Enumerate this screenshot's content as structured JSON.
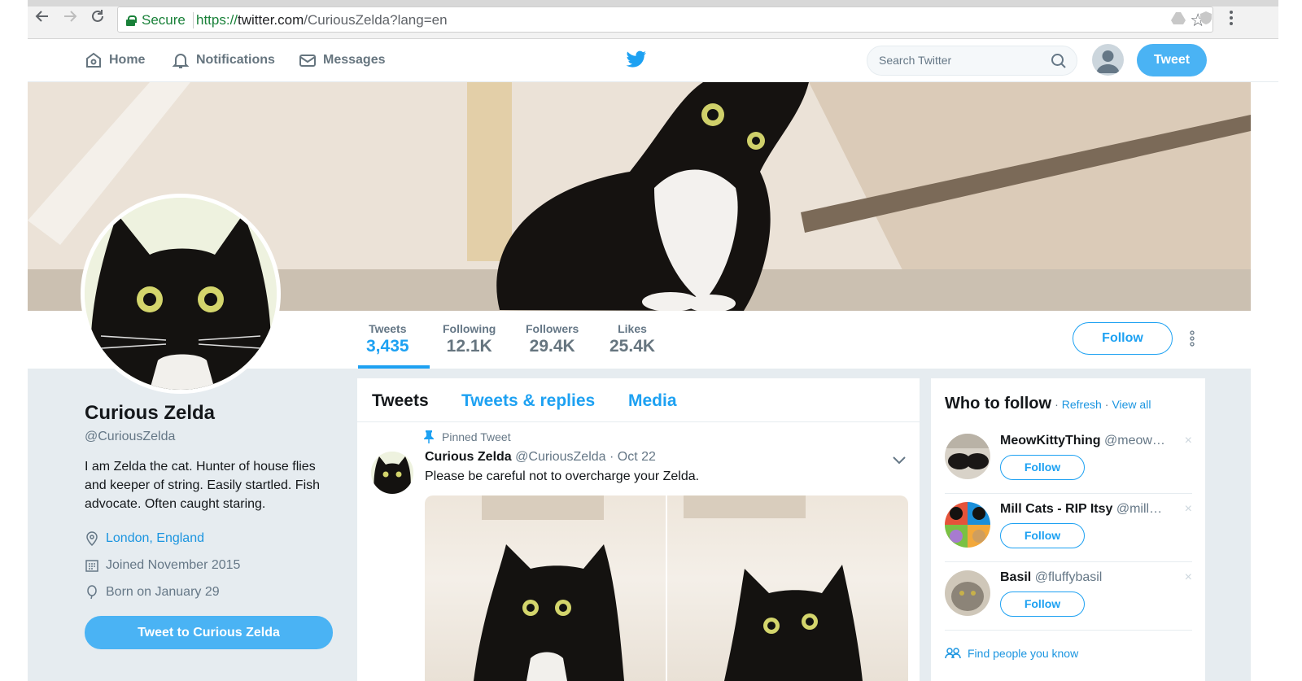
{
  "browser": {
    "secure_label": "Secure",
    "url_scheme": "https://",
    "url_host": "twitter.com",
    "url_path": "/CuriousZelda?lang=en"
  },
  "topnav": {
    "home": "Home",
    "notifications": "Notifications",
    "messages": "Messages",
    "search_placeholder": "Search Twitter",
    "tweet_button": "Tweet"
  },
  "profile": {
    "name": "Curious Zelda",
    "handle": "@CuriousZelda",
    "bio": "I am Zelda the cat. Hunter of house flies and keeper of string. Easily startled. Fish advocate. Often caught staring.",
    "location": "London, England",
    "joined": "Joined November 2015",
    "born": "Born on January 29",
    "tweet_to": "Tweet to Curious Zelda",
    "follow": "Follow"
  },
  "stats": [
    {
      "label": "Tweets",
      "value": "3,435"
    },
    {
      "label": "Following",
      "value": "12.1K"
    },
    {
      "label": "Followers",
      "value": "29.4K"
    },
    {
      "label": "Likes",
      "value": "25.4K"
    }
  ],
  "timeline": {
    "tabs": [
      "Tweets",
      "Tweets & replies",
      "Media"
    ],
    "pinned_label": "Pinned Tweet",
    "tweet": {
      "name": "Curious Zelda",
      "handle": "@CuriousZelda",
      "date": "· Oct 22",
      "text": "Please be careful not to overcharge your Zelda."
    }
  },
  "who_to_follow": {
    "title": "Who to follow",
    "dot1": "·",
    "refresh": "Refresh",
    "dot2": "·",
    "view_all": "View all",
    "follow_label": "Follow",
    "close_glyph": "×",
    "items": [
      {
        "name": "MeowKittyThing",
        "handle": "@meow…"
      },
      {
        "name": "Mill Cats - RIP Itsy",
        "handle": "@mill…"
      },
      {
        "name": "Basil",
        "handle": "@fluffybasil"
      }
    ],
    "find_people": "Find people you know"
  },
  "colors": {
    "accent": "#1da1f2",
    "tweet_button": "#4ab3f4",
    "secure_green": "#188038",
    "muted": "#657786"
  }
}
